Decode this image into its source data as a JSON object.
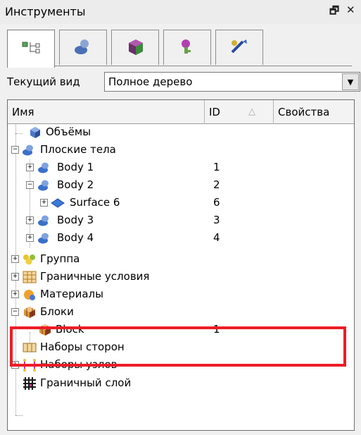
{
  "titlebar": {
    "title": "Инструменты",
    "pin_glyph": "🗗",
    "close_glyph": "✕"
  },
  "tabs": [
    {
      "name": "tree-tab",
      "icon": "tree-icon"
    },
    {
      "name": "mesh-tab",
      "icon": "mesh-icon"
    },
    {
      "name": "block-tab",
      "icon": "block-icon"
    },
    {
      "name": "properties-tab",
      "icon": "properties-icon"
    },
    {
      "name": "tools-tab",
      "icon": "tools-icon"
    }
  ],
  "view": {
    "label": "Текущий вид",
    "value": "Полное дерево",
    "arrow": "▼"
  },
  "columns": {
    "name": "Имя",
    "id": "ID",
    "props": "Свойства",
    "sort_glyph": "△"
  },
  "rows": [
    {
      "label": "Объёмы",
      "id": ""
    },
    {
      "label": "Плоские тела",
      "id": ""
    },
    {
      "label": "Body 1",
      "id": "1"
    },
    {
      "label": "Body 2",
      "id": "2"
    },
    {
      "label": "Surface 6",
      "id": "6"
    },
    {
      "label": "Body 3",
      "id": "3"
    },
    {
      "label": "Body 4",
      "id": "4"
    },
    {
      "label": "Группа",
      "id": ""
    },
    {
      "label": "Граничные условия",
      "id": ""
    },
    {
      "label": "Материалы",
      "id": ""
    },
    {
      "label": "Блоки",
      "id": ""
    },
    {
      "label": "Block",
      "id": "1"
    },
    {
      "label": "Наборы сторон",
      "id": ""
    },
    {
      "label": "Наборы узлов",
      "id": ""
    },
    {
      "label": "Граничный слой",
      "id": ""
    }
  ],
  "expander": {
    "plus": "+",
    "minus": "−"
  },
  "colors": {
    "highlight": "#ee1c25",
    "body": "#3b7fd0",
    "block": "#d8963a"
  }
}
